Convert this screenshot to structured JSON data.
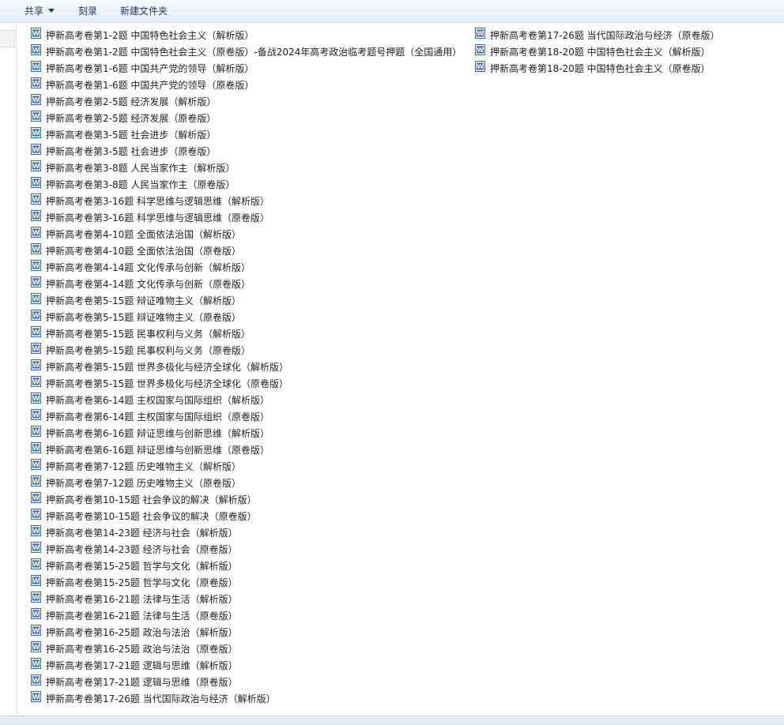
{
  "toolbar": {
    "share_label": "共享",
    "burn_label": "刻录",
    "new_folder_label": "新建文件夹"
  },
  "files": [
    {
      "name": "押新高考卷第1-2题 中国特色社会主义（解析版）",
      "icon": "word-doc-icon"
    },
    {
      "name": "押新高考卷第1-2题 中国特色社会主义（原卷版）-备战2024年高考政治临考题号押题（全国通用）",
      "icon": "word-doc-icon"
    },
    {
      "name": "押新高考卷第1-6题 中国共产党的领导（解析版）",
      "icon": "word-doc-icon"
    },
    {
      "name": "押新高考卷第1-6题 中国共产党的领导（原卷版）",
      "icon": "word-doc-icon"
    },
    {
      "name": "押新高考卷第2-5题 经济发展（解析版）",
      "icon": "word-doc-icon"
    },
    {
      "name": "押新高考卷第2-5题 经济发展（原卷版）",
      "icon": "word-doc-icon"
    },
    {
      "name": "押新高考卷第3-5题 社会进步（解析版）",
      "icon": "word-doc-icon"
    },
    {
      "name": "押新高考卷第3-5题 社会进步（原卷版）",
      "icon": "word-doc-icon"
    },
    {
      "name": "押新高考卷第3-8题 人民当家作主（解析版）",
      "icon": "word-doc-icon"
    },
    {
      "name": "押新高考卷第3-8题 人民当家作主（原卷版）",
      "icon": "word-doc-icon"
    },
    {
      "name": "押新高考卷第3-16题 科学思维与逻辑思维（解析版）",
      "icon": "word-doc-icon"
    },
    {
      "name": "押新高考卷第3-16题 科学思维与逻辑思维（原卷版）",
      "icon": "word-doc-icon"
    },
    {
      "name": "押新高考卷第4-10题 全面依法治国（解析版）",
      "icon": "word-doc-icon"
    },
    {
      "name": "押新高考卷第4-10题 全面依法治国（原卷版）",
      "icon": "word-doc-icon"
    },
    {
      "name": "押新高考卷第4-14题 文化传承与创新（解析版）",
      "icon": "word-doc-icon"
    },
    {
      "name": "押新高考卷第4-14题 文化传承与创新（原卷版）",
      "icon": "word-doc-icon"
    },
    {
      "name": "押新高考卷第5-15题  辩证唯物主义（解析版）",
      "icon": "word-doc-icon"
    },
    {
      "name": "押新高考卷第5-15题  辩证唯物主义（原卷版）",
      "icon": "word-doc-icon"
    },
    {
      "name": "押新高考卷第5-15题 民事权利与义务（解析版）",
      "icon": "word-doc-icon"
    },
    {
      "name": "押新高考卷第5-15题 民事权利与义务（原卷版）",
      "icon": "word-doc-icon"
    },
    {
      "name": "押新高考卷第5-15题 世界多极化与经济全球化（解析版）",
      "icon": "word-doc-icon"
    },
    {
      "name": "押新高考卷第5-15题 世界多极化与经济全球化（原卷版）",
      "icon": "word-doc-icon"
    },
    {
      "name": "押新高考卷第6-14题 主权国家与国际组织（解析版）",
      "icon": "word-doc-icon"
    },
    {
      "name": "押新高考卷第6-14题 主权国家与国际组织（原卷版）",
      "icon": "word-doc-icon"
    },
    {
      "name": "押新高考卷第6-16题 辩证思维与创新思维（解析版）",
      "icon": "word-doc-icon"
    },
    {
      "name": "押新高考卷第6-16题 辩证思维与创新思维（原卷版）",
      "icon": "word-doc-icon"
    },
    {
      "name": "押新高考卷第7-12题 历史唯物主义（解析版）",
      "icon": "word-doc-icon"
    },
    {
      "name": "押新高考卷第7-12题 历史唯物主义（原卷版）",
      "icon": "word-doc-icon"
    },
    {
      "name": "押新高考卷第10-15题 社会争议的解决（解析版）",
      "icon": "word-doc-icon"
    },
    {
      "name": "押新高考卷第10-15题 社会争议的解决（原卷版）",
      "icon": "word-doc-icon"
    },
    {
      "name": "押新高考卷第14-23题 经济与社会（解析版）",
      "icon": "word-doc-icon"
    },
    {
      "name": "押新高考卷第14-23题 经济与社会（原卷版）",
      "icon": "word-doc-icon"
    },
    {
      "name": "押新高考卷第15-25题 哲学与文化（解析版）",
      "icon": "word-doc-icon"
    },
    {
      "name": "押新高考卷第15-25题 哲学与文化（原卷版）",
      "icon": "word-doc-icon"
    },
    {
      "name": "押新高考卷第16-21题 法律与生活（解析版）",
      "icon": "word-doc-icon"
    },
    {
      "name": "押新高考卷第16-21题 法律与生活（原卷版）",
      "icon": "word-doc-icon"
    },
    {
      "name": "押新高考卷第16-25题 政治与法治（解析版）",
      "icon": "word-doc-icon"
    },
    {
      "name": "押新高考卷第16-25题 政治与法治（原卷版）",
      "icon": "word-doc-icon"
    },
    {
      "name": "押新高考卷第17-21题 逻辑与思维（解析版）",
      "icon": "word-doc-icon"
    },
    {
      "name": "押新高考卷第17-21题 逻辑与思维（原卷版）",
      "icon": "word-doc-icon"
    },
    {
      "name": "押新高考卷第17-26题 当代国际政治与经济（解析版）",
      "icon": "word-doc-icon"
    },
    {
      "name": "押新高考卷第17-26题 当代国际政治与经济（原卷版）",
      "icon": "word-doc-icon"
    },
    {
      "name": "押新高考卷第18-20题 中国特色社会主义（解析版）",
      "icon": "word-doc-icon"
    },
    {
      "name": "押新高考卷第18-20题 中国特色社会主义（原卷版）",
      "icon": "word-doc-icon"
    }
  ],
  "colors": {
    "toolbar_text": "#1e395b",
    "word_icon_blue": "#2b6cc4"
  }
}
